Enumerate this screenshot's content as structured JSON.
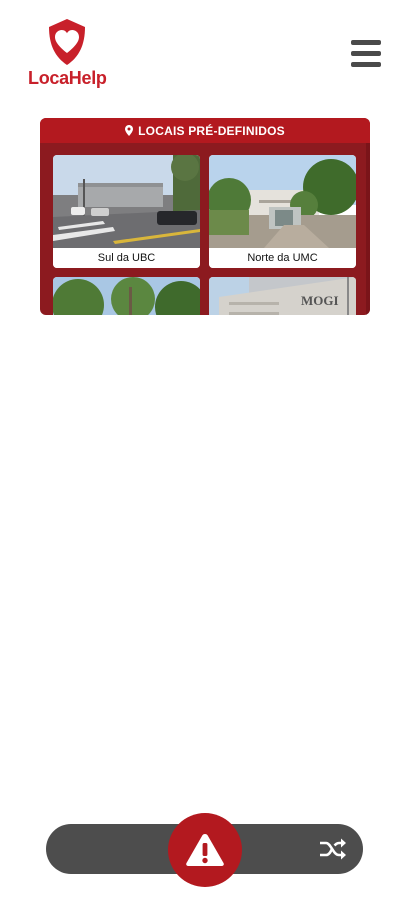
{
  "app": {
    "name": "LocaHelp",
    "brand_color": "#c8202a",
    "logo_icon": "shield-heart-icon"
  },
  "header": {
    "menu_icon": "hamburger-menu-icon"
  },
  "presets": {
    "title": "LOCAIS PRÉ-DEFINIDOS",
    "title_icon": "map-pin-icon",
    "locations": [
      {
        "label": "Sul da UBC"
      },
      {
        "label": "Norte da UMC"
      },
      {
        "label": ""
      },
      {
        "label": ""
      }
    ],
    "sign_text": "MOGI"
  },
  "bottom_bar": {
    "alert_icon": "warning-triangle-icon",
    "shuffle_icon": "shuffle-icon",
    "alert_color": "#b3191f"
  }
}
